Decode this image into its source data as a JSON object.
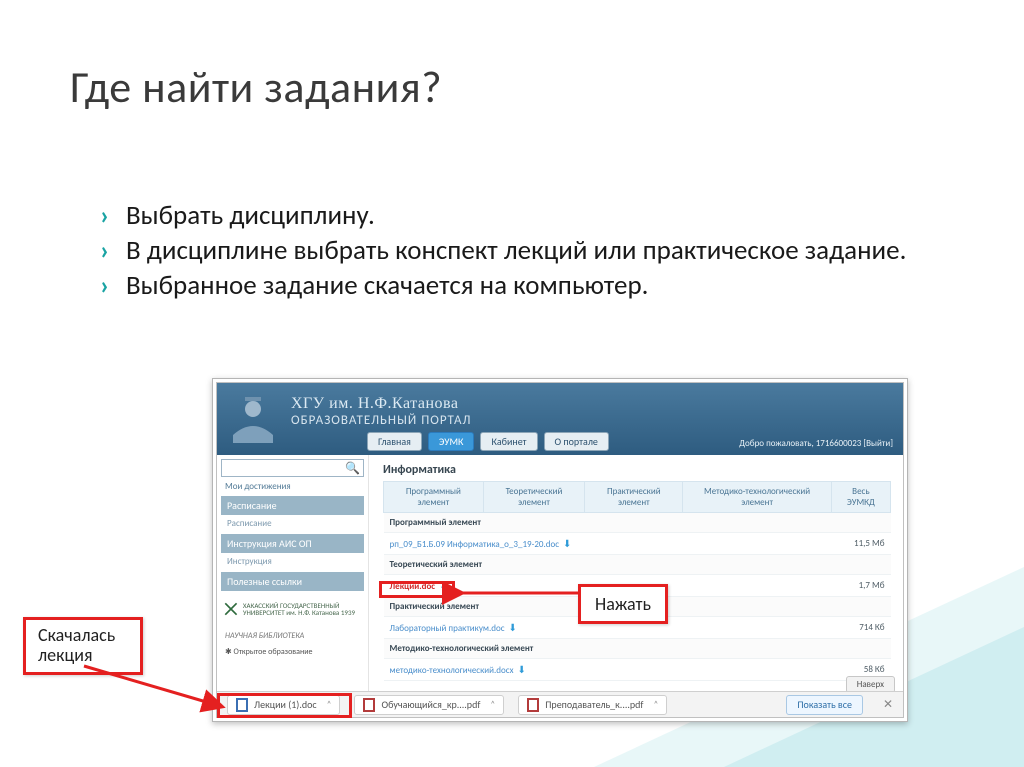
{
  "title": "Где найти задания?",
  "bullets": [
    "Выбрать дисциплину.",
    "В дисциплине выбрать конспект лекций или практическое задание.",
    "Выбранное задание скачается на компьютер."
  ],
  "portal": {
    "title1": "ХГУ им. Н.Ф.Катанова",
    "title2": "ОБРАЗОВАТЕЛЬНЫЙ ПОРТАЛ",
    "menu": {
      "main": "Главная",
      "eumk": "ЭУМК",
      "cabinet": "Кабинет",
      "about": "О портале"
    },
    "welcome": "Добро пожаловать, 1716600023 [Выйти]"
  },
  "sidebar": {
    "ach": "Мои достижения",
    "sched_head": "Расписание",
    "sched_item": "Расписание",
    "instr_head": "Инструкция АИС ОП",
    "instr_item": "Инструкция",
    "links_head": "Полезные ссылки",
    "univ": "ХАКАССКИЙ ГОСУДАРСТВЕННЫЙ УНИВЕРСИТЕТ им. Н.Ф. Катанова 1939",
    "lib": "НАУЧНАЯ БИБЛИОТЕКА",
    "edu": "Открытое образование"
  },
  "main": {
    "discipline": "Информатика",
    "cols": {
      "c1": "Программный элемент",
      "c2": "Теоретический элемент",
      "c3": "Практический элемент",
      "c4": "Методико-технологический элемент",
      "c5": "Весь ЭУМКД"
    },
    "g1": "Программный элемент",
    "f1": {
      "name": "рп_09_Б1.Б.09 Информатика_о_3_19-20.doc",
      "size": "11,5 Мб"
    },
    "g2": "Теоретический элемент",
    "f2": {
      "name": "Лекции.doc",
      "size": "1,7 Мб"
    },
    "g3": "Практический элемент",
    "f3": {
      "name": "Лабораторный практикум.doc",
      "size": "714 Кб"
    },
    "g4": "Методико-технологический элемент",
    "f4": {
      "name": "методико-технологический.docx",
      "size": "58 Кб"
    },
    "up": "Наверх"
  },
  "dlbar": {
    "chip1": "Лекции (1).doc",
    "chip2": "Обучающийся_кр....pdf",
    "chip3": "Преподаватель_к....pdf",
    "showall": "Показать все"
  },
  "annot": {
    "press": "Нажать",
    "downloaded": "Скачалась лекция"
  }
}
